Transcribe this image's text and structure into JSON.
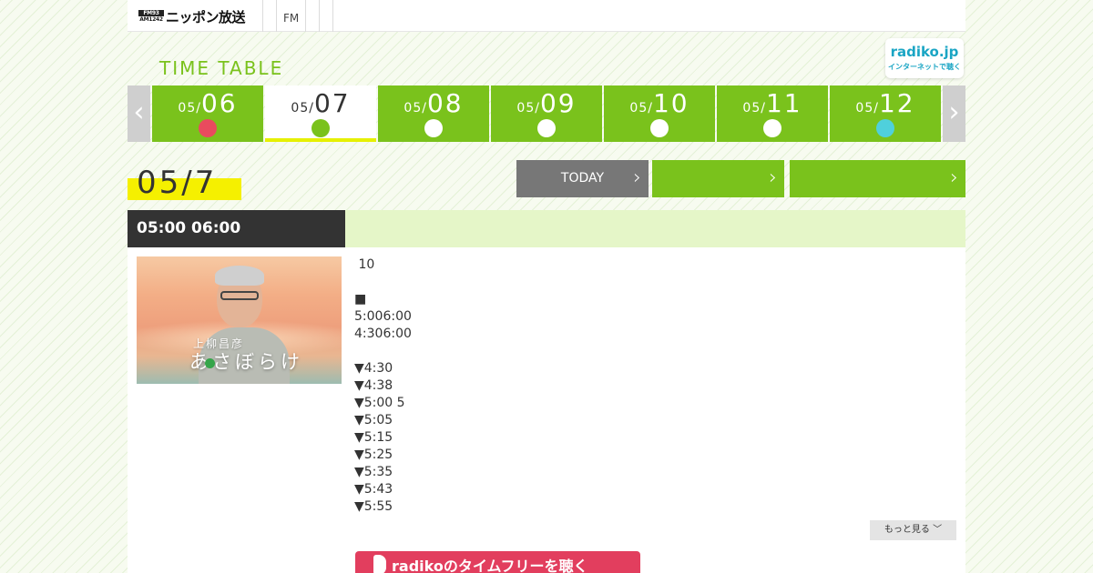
{
  "nav": {
    "logo_mark_top": "FM93",
    "logo_mark_bottom": "AM1242",
    "logo_text": "ニッポン放送",
    "tab_fm": "FM"
  },
  "header": {
    "title": "TIME TABLE",
    "radiko_top": "radiko.jp",
    "radiko_bottom": "インターネットで聴く"
  },
  "date_strip": {
    "prev_arrow": "‹",
    "next_arrow": "›",
    "days": [
      {
        "month": "05/",
        "day": "06",
        "dot_color": "#e94b5e",
        "active": false
      },
      {
        "month": "05/",
        "day": "07",
        "dot_color": "#7ac21c",
        "active": true
      },
      {
        "month": "05/",
        "day": "08",
        "dot_color": "#ffffff",
        "active": false
      },
      {
        "month": "05/",
        "day": "09",
        "dot_color": "#ffffff",
        "active": false
      },
      {
        "month": "05/",
        "day": "10",
        "dot_color": "#ffffff",
        "active": false
      },
      {
        "month": "05/",
        "day": "11",
        "dot_color": "#ffffff",
        "active": false
      },
      {
        "month": "05/",
        "day": "12",
        "dot_color": "#4fd0dc",
        "active": false
      }
    ]
  },
  "selected_date": "05/7",
  "actions": {
    "today_label": "TODAY",
    "today_color": "#777777",
    "green_color": "#7ac21c",
    "chevron": "›"
  },
  "program": {
    "time": "05:00  06:00",
    "thumb_caption_small": "上柳昌彦",
    "thumb_caption_large": "あさぼらけ",
    "lines": [
      " 10",
      "",
      "■",
      "5:006:00",
      "4:306:00",
      "",
      "▼4:30",
      "▼4:38",
      "▼5:00 5",
      "▼5:05",
      "▼5:15",
      "▼5:25",
      "▼5:35",
      "▼5:43",
      "▼5:55"
    ],
    "more_label": "もっと見る ﹀",
    "radiko_button": "radikoのタイムフリーを聴く"
  }
}
